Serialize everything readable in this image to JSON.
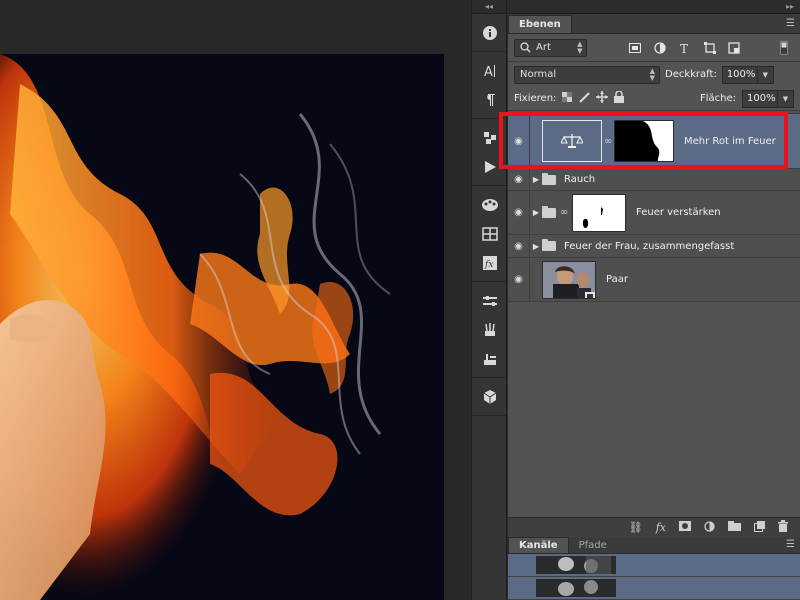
{
  "layers_panel": {
    "tabs": [
      {
        "label": "Ebenen",
        "active": true
      }
    ],
    "filter": {
      "kind_label": "Art"
    },
    "blend_mode": "Normal",
    "opacity": {
      "label": "Deckkraft:",
      "value": "100%"
    },
    "lock": {
      "label": "Fixieren:"
    },
    "fill": {
      "label": "Fläche:",
      "value": "100%"
    },
    "layers": [
      {
        "name": "Mehr Rot im Feuer",
        "type": "adjustment",
        "visible": true,
        "selected": true
      },
      {
        "name": "Rauch",
        "type": "group",
        "visible": true
      },
      {
        "name": "Feuer verstärken",
        "type": "group-with-mask",
        "visible": true
      },
      {
        "name": "Feuer der Frau, zusammengefasst",
        "type": "group",
        "visible": true
      },
      {
        "name": "Paar",
        "type": "smart-object",
        "visible": true
      }
    ],
    "footer_icons": [
      "link-layers-icon",
      "fx-icon",
      "add-mask-icon",
      "adjustment-layer-icon",
      "new-group-icon",
      "new-layer-icon",
      "trash-icon"
    ],
    "footer_fx": "fx"
  },
  "channels_panel": {
    "tabs": [
      {
        "label": "Kanäle",
        "active": true
      },
      {
        "label": "Pfade",
        "active": false
      }
    ]
  },
  "tool_strip": {
    "icons": [
      "info-icon",
      "character-icon",
      "paragraph-icon",
      "history-icon",
      "actions-play-icon",
      "swatches-icon",
      "styles-grid-icon",
      "fx-styles-icon",
      "adjustments-icon",
      "brushes-icon",
      "brush-presets-icon",
      "3d-icon"
    ]
  },
  "colors": {
    "highlight": "#e8141b",
    "selected_layer": "#5b6a85",
    "panel_bg": "#535353"
  }
}
